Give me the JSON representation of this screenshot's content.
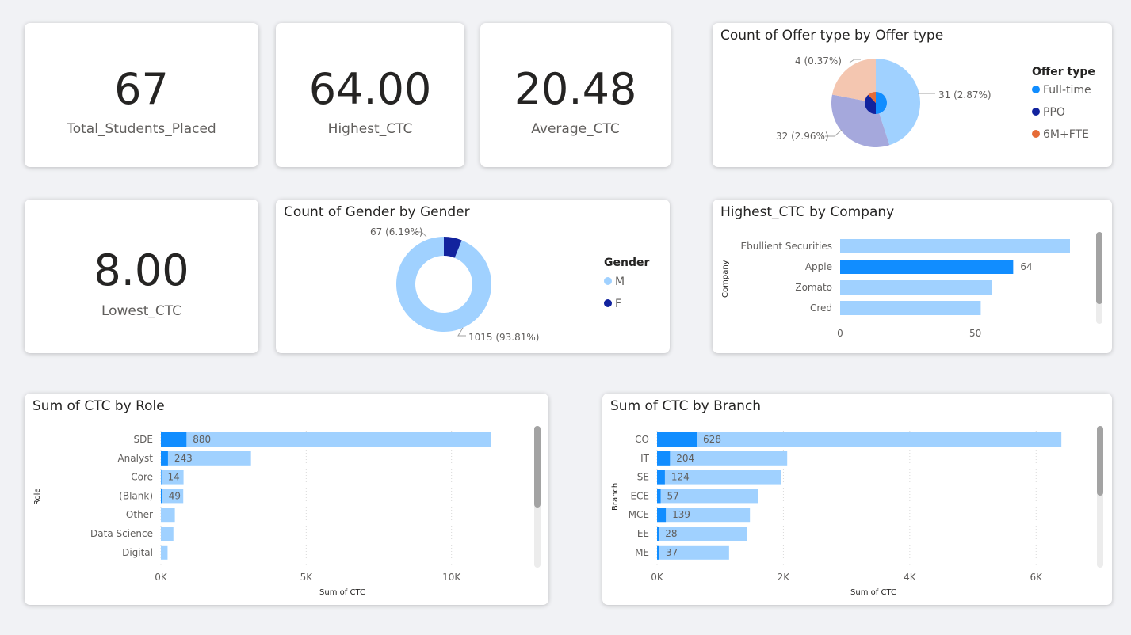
{
  "kpis": {
    "total_students": {
      "value": "67",
      "label": "Total_Students_Placed"
    },
    "highest_ctc": {
      "value": "64.00",
      "label": "Highest_CTC"
    },
    "average_ctc": {
      "value": "20.48",
      "label": "Average_CTC"
    },
    "lowest_ctc": {
      "value": "8.00",
      "label": "Lowest_CTC"
    }
  },
  "colors": {
    "light_blue": "#a0d1ff",
    "blue": "#118dff",
    "navy": "#12239e",
    "orange": "#e66c37",
    "lavender": "#a5a8dc",
    "peach": "#f4c6b0"
  },
  "chart_data": [
    {
      "id": "offer",
      "type": "pie",
      "title": "Count of Offer type by Offer type",
      "legend_title": "Offer type",
      "legend": [
        {
          "name": "Full-time",
          "color": "#118dff"
        },
        {
          "name": "PPO",
          "color": "#12239e"
        },
        {
          "name": "6M+FTE",
          "color": "#e66c37"
        }
      ],
      "outer_slices": [
        {
          "value": 45,
          "color": "#a0d1ff"
        },
        {
          "value": 33,
          "color": "#a5a8dc"
        },
        {
          "value": 22,
          "color": "#f4c6b0"
        }
      ],
      "inner_slices": [
        {
          "value": 50,
          "color": "#118dff"
        },
        {
          "value": 38,
          "color": "#12239e"
        },
        {
          "value": 12,
          "color": "#e66c37"
        }
      ],
      "data_labels": [
        "31 (2.87%)",
        "32 (2.96%)",
        "4 (0.37%)"
      ]
    },
    {
      "id": "gender",
      "type": "pie",
      "title": "Count of Gender by Gender",
      "legend_title": "Gender",
      "legend": [
        {
          "name": "M",
          "color": "#a0d1ff"
        },
        {
          "name": "F",
          "color": "#12239e"
        }
      ],
      "slices": [
        {
          "name": "F",
          "value": 67,
          "label": "67 (6.19%)",
          "color": "#12239e"
        },
        {
          "name": "M",
          "value": 1015,
          "label": "1015 (93.81%)",
          "color": "#a0d1ff"
        }
      ]
    },
    {
      "id": "company",
      "type": "bar",
      "title": "Highest_CTC by Company",
      "ylabel": "Company",
      "categories": [
        "Ebullient Securities",
        "Apple",
        "Zomato",
        "Cred"
      ],
      "values": [
        85,
        64,
        56,
        52
      ],
      "highlight_index": 1,
      "highlight_label": "64",
      "xticks": [
        "0",
        "50"
      ],
      "xlim": [
        0,
        85
      ]
    },
    {
      "id": "role",
      "type": "bar",
      "title": "Sum of CTC by Role",
      "xlabel": "Sum of CTC",
      "ylabel": "Role",
      "categories": [
        "SDE",
        "Analyst",
        "Core",
        "(Blank)",
        "Other",
        "Data Science",
        "Digital"
      ],
      "values": [
        11350,
        3100,
        780,
        770,
        480,
        430,
        230
      ],
      "highlight_values": [
        880,
        243,
        14,
        49,
        0,
        0,
        0
      ],
      "highlight_labels": [
        "880",
        "243",
        "14",
        "49",
        "",
        "",
        ""
      ],
      "xticks": [
        {
          "value": 0,
          "label": "0K"
        },
        {
          "value": 5000,
          "label": "5K"
        },
        {
          "value": 10000,
          "label": "10K"
        }
      ],
      "xlim": [
        0,
        12000
      ]
    },
    {
      "id": "branch",
      "type": "bar",
      "title": "Sum of CTC by Branch",
      "xlabel": "Sum of CTC",
      "ylabel": "Branch",
      "categories": [
        "CO",
        "IT",
        "SE",
        "ECE",
        "MCE",
        "EE",
        "ME"
      ],
      "values": [
        6400,
        2060,
        1960,
        1600,
        1470,
        1420,
        1140
      ],
      "highlight_values": [
        628,
        204,
        124,
        57,
        139,
        28,
        37
      ],
      "highlight_labels": [
        "628",
        "204",
        "124",
        "57",
        "139",
        "28",
        "37"
      ],
      "xticks": [
        {
          "value": 0,
          "label": "0K"
        },
        {
          "value": 2000,
          "label": "2K"
        },
        {
          "value": 4000,
          "label": "4K"
        },
        {
          "value": 6000,
          "label": "6K"
        }
      ],
      "xlim": [
        0,
        6900
      ]
    }
  ]
}
